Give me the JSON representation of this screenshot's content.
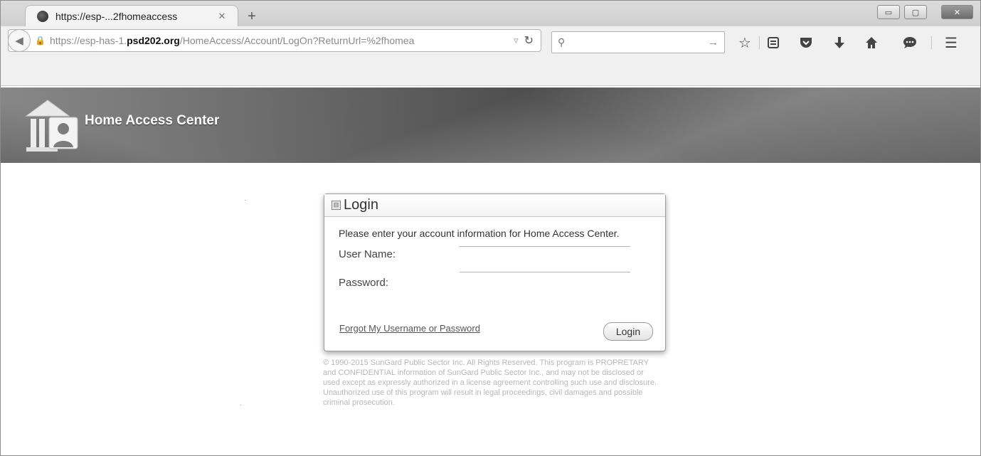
{
  "browser": {
    "tab_title": "https://esp-...2fhomeaccess",
    "tab_close": "✕",
    "new_tab": "+",
    "url_prefix": "https://esp-has-1.",
    "url_domain": "psd202.org",
    "url_path": "/HomeAccess/Account/LogOn?ReturnUrl=%2fhomea",
    "url_extra": "▿",
    "search_placeholder": "",
    "icons": [
      "back-icon",
      "lock-icon",
      "reload-icon",
      "search-icon",
      "go-arrow-icon",
      "bookmark-star-icon",
      "reading-list-icon",
      "pocket-icon",
      "download-icon",
      "home-icon",
      "chat-icon",
      "menu-icon"
    ]
  },
  "window_controls": {
    "minimize": "▭",
    "maximize": "▢",
    "close": "✕"
  },
  "header": {
    "app_title": "Home Access Center"
  },
  "login": {
    "title": "Login",
    "intro": "Please enter your account information for Home Access Center.",
    "username_label": "User Name:",
    "username_value": "",
    "password_label": "Password:",
    "password_value": "",
    "forgot_link": "Forgot My Username or Password",
    "button": "Login"
  },
  "footer": {
    "copyright": "© 1990-2015 SunGard Public Sector Inc. All Rights Reserved. This program is PROPRETARY and CONFIDENTIAL information of SunGard Public Sector Inc., and may not be disclosed or used except as expressly authorized in a license agreement controlling such use and disclosure. Unauthorized use of this program will result in legal proceedings, civil damages and possible criminal prosecution."
  }
}
